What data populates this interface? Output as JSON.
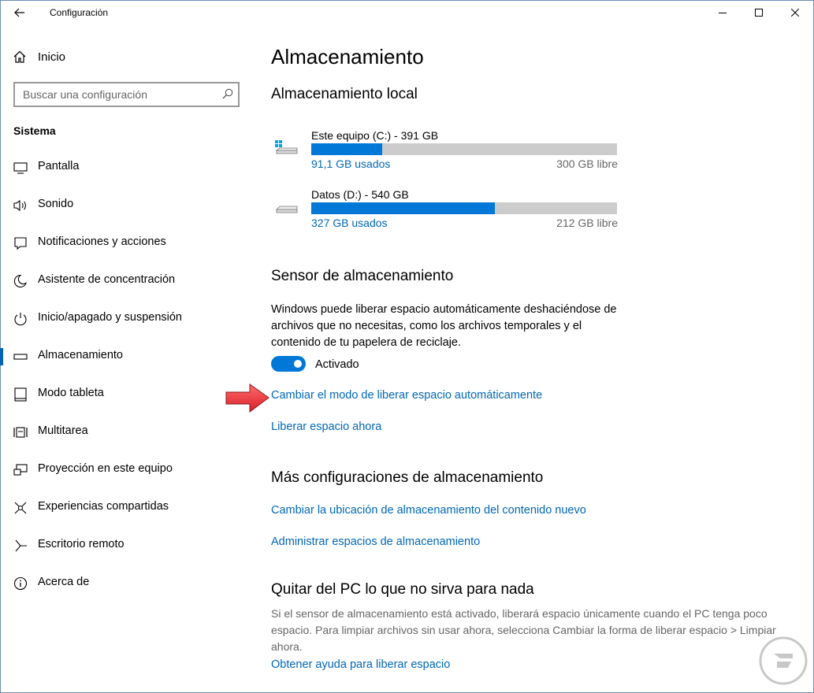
{
  "window": {
    "title": "Configuración"
  },
  "sidebar": {
    "home_label": "Inicio",
    "search_placeholder": "Buscar una configuración",
    "section_label": "Sistema",
    "items": [
      {
        "label": "Pantalla",
        "icon": "monitor-icon"
      },
      {
        "label": "Sonido",
        "icon": "speaker-icon"
      },
      {
        "label": "Notificaciones y acciones",
        "icon": "notification-icon"
      },
      {
        "label": "Asistente de concentración",
        "icon": "moon-icon"
      },
      {
        "label": "Inicio/apagado y suspensión",
        "icon": "power-icon"
      },
      {
        "label": "Almacenamiento",
        "icon": "storage-icon",
        "selected": true
      },
      {
        "label": "Modo tableta",
        "icon": "tablet-icon"
      },
      {
        "label": "Multitarea",
        "icon": "multitask-icon"
      },
      {
        "label": "Proyección en este equipo",
        "icon": "projection-icon"
      },
      {
        "label": "Experiencias compartidas",
        "icon": "shared-icon"
      },
      {
        "label": "Escritorio remoto",
        "icon": "remote-icon"
      },
      {
        "label": "Acerca de",
        "icon": "info-icon"
      }
    ]
  },
  "main": {
    "title": "Almacenamiento",
    "local_storage_heading": "Almacenamiento local",
    "drives": [
      {
        "name": "Este equipo (C:) - 391 GB",
        "used": "91,1 GB usados",
        "free": "300 GB libre",
        "used_fraction": 0.233
      },
      {
        "name": "Datos (D:) - 540 GB",
        "used": "327 GB usados",
        "free": "212 GB libre",
        "used_fraction": 0.6
      }
    ],
    "sensor_heading": "Sensor de almacenamiento",
    "sensor_description": "Windows puede liberar espacio automáticamente deshaciéndose de archivos que no necesitas, como los archivos temporales y el contenido de tu papelera de reciclaje.",
    "toggle_label": "Activado",
    "toggle_on": true,
    "link_change_mode": "Cambiar el modo de liberar espacio automáticamente",
    "link_free_now": "Liberar espacio ahora",
    "more_heading": "Más configuraciones de almacenamiento",
    "link_change_location": "Cambiar la ubicación de almacenamiento del contenido nuevo",
    "link_manage_spaces": "Administrar espacios de almacenamiento",
    "remove_heading": "Quitar del PC lo que no sirva para nada",
    "remove_description": "Si el sensor de almacenamiento está activado, liberará espacio únicamente cuando el PC tenga poco espacio. Para limpiar archivos sin usar ahora, selecciona Cambiar la forma de liberar espacio > Limpiar ahora.",
    "link_help": "Obtener ayuda para liberar espacio"
  },
  "colors": {
    "accent": "#0078d7",
    "link": "#0067b8",
    "arrow": "#e8323c"
  }
}
